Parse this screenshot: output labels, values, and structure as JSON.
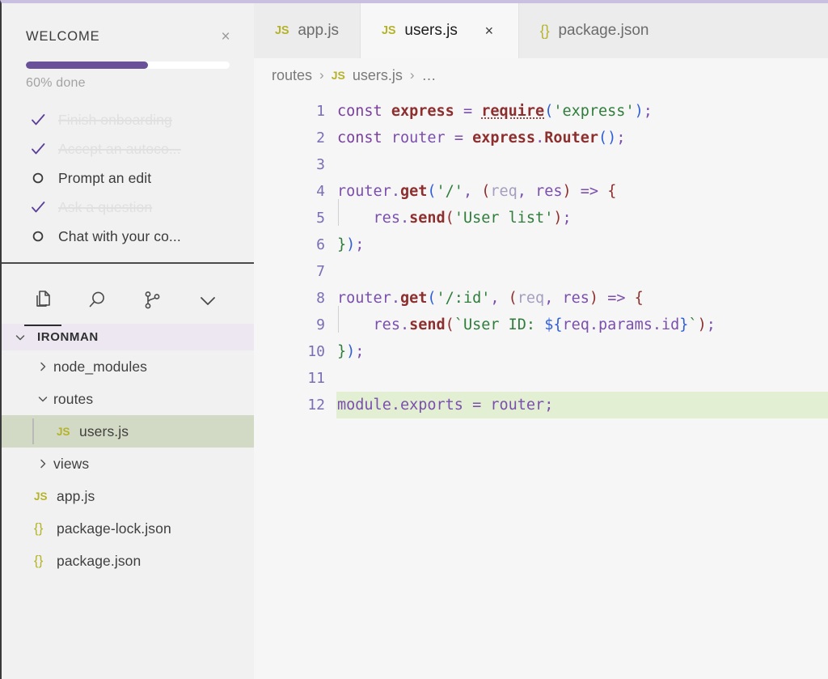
{
  "theme": {
    "accent_purple": "#6a5099",
    "top_border": "#c9bfe0",
    "selection_green": "#d2d9c4",
    "added_line_green": "#e2efd3",
    "root_header_purple": "#ece7f0",
    "js_badge": "#b5b329"
  },
  "welcome": {
    "title": "WELCOME",
    "close_label": "×",
    "close_icon": "close-icon",
    "progress_percent": 60,
    "progress_label": "60% done",
    "items": [
      {
        "label": "Finish onboarding",
        "state": "done",
        "icon": "check-icon"
      },
      {
        "label": "Accept an autoco...",
        "state": "done",
        "icon": "check-icon"
      },
      {
        "label": "Prompt an edit",
        "state": "todo",
        "icon": "circle-icon"
      },
      {
        "label": "Ask a question",
        "state": "done",
        "icon": "check-icon"
      },
      {
        "label": "Chat with your co...",
        "state": "todo",
        "icon": "circle-icon"
      }
    ]
  },
  "activity_bar": {
    "icons": [
      {
        "name": "explorer-files-icon",
        "active": true
      },
      {
        "name": "search-icon",
        "active": false
      },
      {
        "name": "source-control-branch-icon",
        "active": false
      },
      {
        "name": "chevron-down-icon",
        "active": false
      }
    ]
  },
  "explorer": {
    "root": {
      "label": "IRONMAN",
      "expanded": true,
      "twisty": "chevron-down-icon"
    },
    "tree": [
      {
        "label": "node_modules",
        "kind": "folder",
        "expanded": false,
        "depth": 1,
        "selected": false,
        "twisty": "chevron-right-icon"
      },
      {
        "label": "routes",
        "kind": "folder",
        "expanded": true,
        "depth": 1,
        "selected": false,
        "twisty": "chevron-down-icon"
      },
      {
        "label": "users.js",
        "kind": "js",
        "depth": 2,
        "selected": true,
        "badge": "JS"
      },
      {
        "label": "views",
        "kind": "folder",
        "expanded": false,
        "depth": 1,
        "selected": false,
        "twisty": "chevron-right-icon"
      },
      {
        "label": "app.js",
        "kind": "js",
        "depth": 1,
        "selected": false,
        "badge": "JS"
      },
      {
        "label": "package-lock.json",
        "kind": "json",
        "depth": 1,
        "selected": false,
        "badge": "{}"
      },
      {
        "label": "package.json",
        "kind": "json",
        "depth": 1,
        "selected": false,
        "badge": "{}"
      }
    ]
  },
  "tabs": [
    {
      "label": "app.js",
      "badge": "JS",
      "kind": "js",
      "active": false,
      "closable": false
    },
    {
      "label": "users.js",
      "badge": "JS",
      "kind": "js",
      "active": true,
      "closable": true,
      "close_icon": "close-icon",
      "close_label": "×"
    },
    {
      "label": "package.json",
      "badge": "{}",
      "kind": "json",
      "active": false,
      "closable": false
    }
  ],
  "breadcrumb": {
    "separator": "›",
    "segments": [
      {
        "text": "routes",
        "badge": ""
      },
      {
        "text": "users.js",
        "badge": "JS"
      },
      {
        "text": "…",
        "badge": ""
      }
    ]
  },
  "editor": {
    "language": "javascript",
    "line_numbers": [
      1,
      2,
      3,
      4,
      5,
      6,
      7,
      8,
      9,
      10,
      11,
      12
    ],
    "added_lines": [
      12
    ],
    "lines": [
      "const express = require('express');",
      "const router = express.Router();",
      "",
      "router.get('/', (req, res) => {",
      "    res.send('User list');",
      "});",
      "",
      "router.get('/:id', (req, res) => {",
      "    res.send(`User ID: ${req.params.id}`);",
      "});",
      "",
      "module.exports = router;"
    ]
  }
}
